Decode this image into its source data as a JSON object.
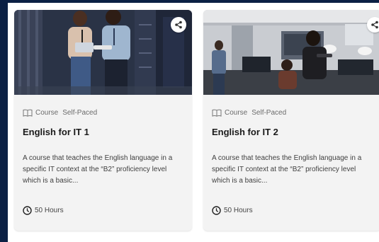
{
  "cards": [
    {
      "type_label": "Course",
      "pace_label": "Self-Paced",
      "title": "English for IT 1",
      "description": "A course that teaches the English language in a specific IT context at the “B2” proficiency level which is a basic...",
      "duration": "50 Hours",
      "image_icon": "photo-two-people-with-tablet-in-server-room",
      "share_icon": "share-icon"
    },
    {
      "type_label": "Course",
      "pace_label": "Self-Paced",
      "title": "English for IT 2",
      "description": "A course that teaches the English language in a specific IT context at the “B2” proficiency level which is a basic...",
      "duration": "50 Hours",
      "image_icon": "photo-people-working-in-office",
      "share_icon": "share-icon"
    }
  ],
  "colors": {
    "page_background": "#0b2044",
    "card_background": "#f3f3f3",
    "title_text": "#1a1a1a",
    "meta_text": "#6b6b6b"
  }
}
